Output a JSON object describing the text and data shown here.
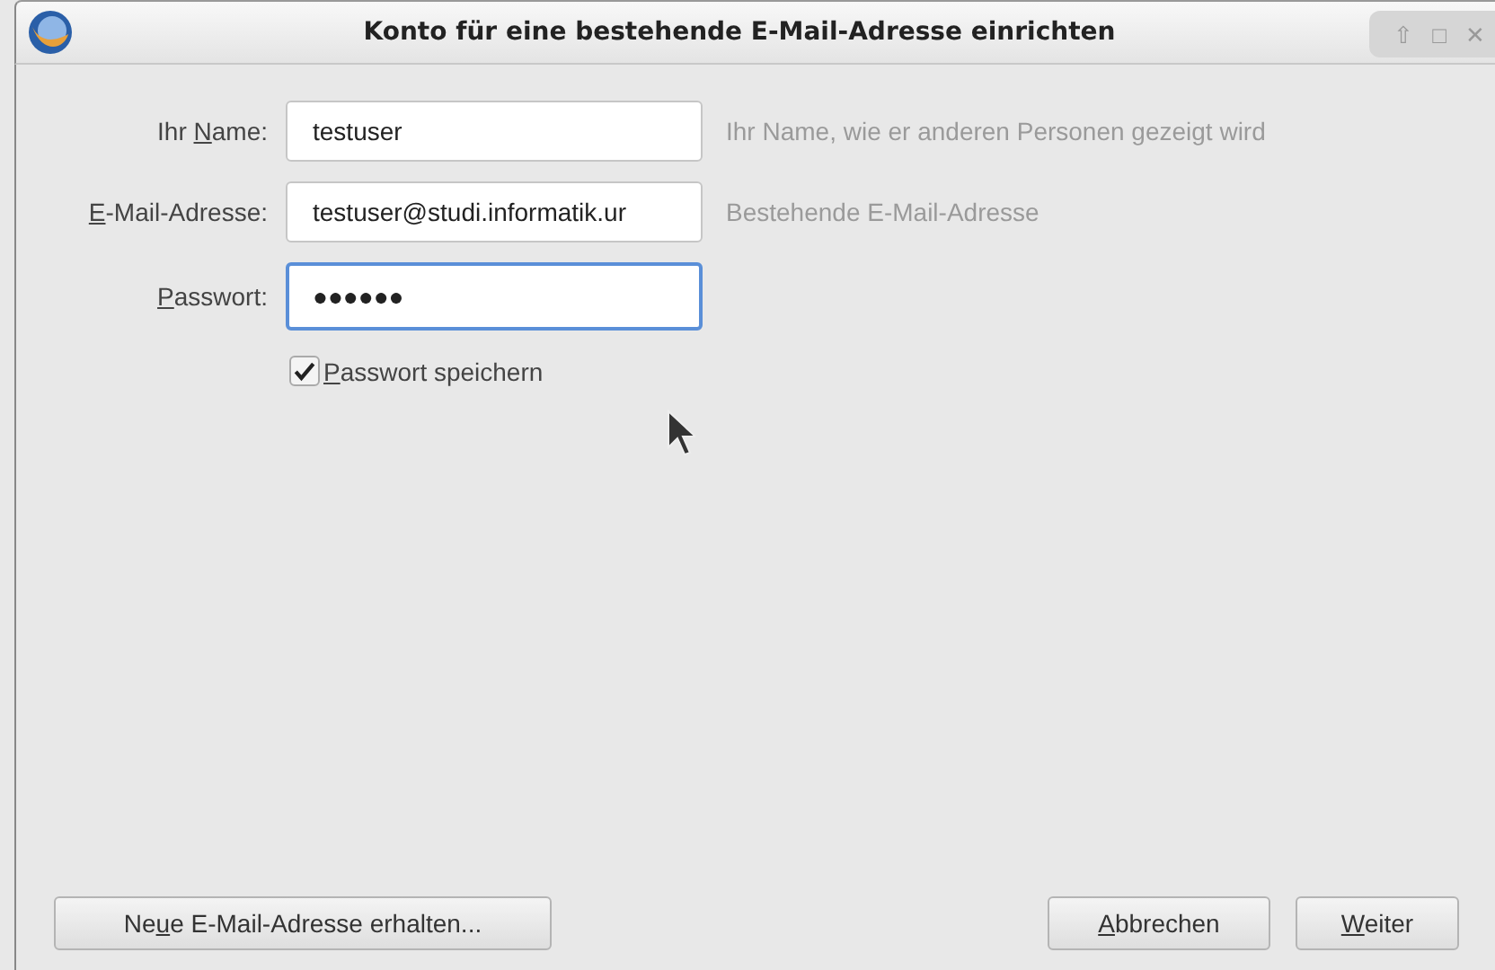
{
  "window": {
    "title": "Konto für eine bestehende E-Mail-Adresse einrichten",
    "controls": [
      "⇧",
      "□",
      "✕"
    ]
  },
  "fields": [
    {
      "label": {
        "pre": "Ihr ",
        "key": "N",
        "post": "ame:"
      },
      "value": "testuser",
      "hint": "Ihr Name, wie er anderen Personen gezeigt wird",
      "focused": false
    },
    {
      "label": {
        "key": "E",
        "post": "-Mail-Adresse:"
      },
      "value": "testuser@studi.informatik.ur",
      "hint": "Bestehende E-Mail-Adresse",
      "focused": false
    },
    {
      "label": {
        "key": "P",
        "post": "asswort:"
      },
      "value": "●●●●●●",
      "focused": true
    }
  ],
  "remember_password": {
    "label": {
      "key": "P",
      "post": "asswort speichern"
    },
    "checked": true
  },
  "buttons": [
    {
      "label": {
        "pre": "Ne",
        "key": "u",
        "post": "e E-Mail-Adresse erhalten..."
      },
      "kind": "left"
    },
    {
      "label": {
        "key": "A",
        "post": "bbrechen"
      },
      "kind": "right"
    },
    {
      "label": {
        "key": "W",
        "post": "eiter"
      },
      "kind": "right"
    }
  ]
}
